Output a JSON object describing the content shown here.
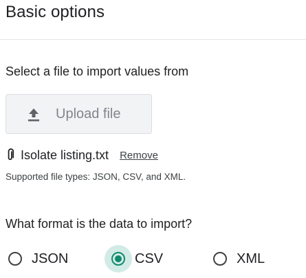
{
  "section": {
    "title": "Basic options"
  },
  "file_import": {
    "question": "Select a file to import values from",
    "upload_button_label": "Upload file",
    "upload_icon": "upload-icon",
    "attached_file_icon": "paperclip-icon",
    "attached_file_name": "Isolate listing.txt",
    "remove_label": "Remove",
    "supported_types_text": "Supported file types: JSON, CSV, and XML."
  },
  "format": {
    "question": "What format is the data to import?",
    "options": [
      {
        "label": "JSON",
        "selected": false
      },
      {
        "label": "CSV",
        "selected": true
      },
      {
        "label": "XML",
        "selected": false
      }
    ],
    "selected_value": "CSV"
  },
  "colors": {
    "accent": "#0f8a6c",
    "accent_halo": "#d2ebe6",
    "button_bg": "#f1f3f4",
    "button_text": "#80868b",
    "text": "#202124"
  }
}
